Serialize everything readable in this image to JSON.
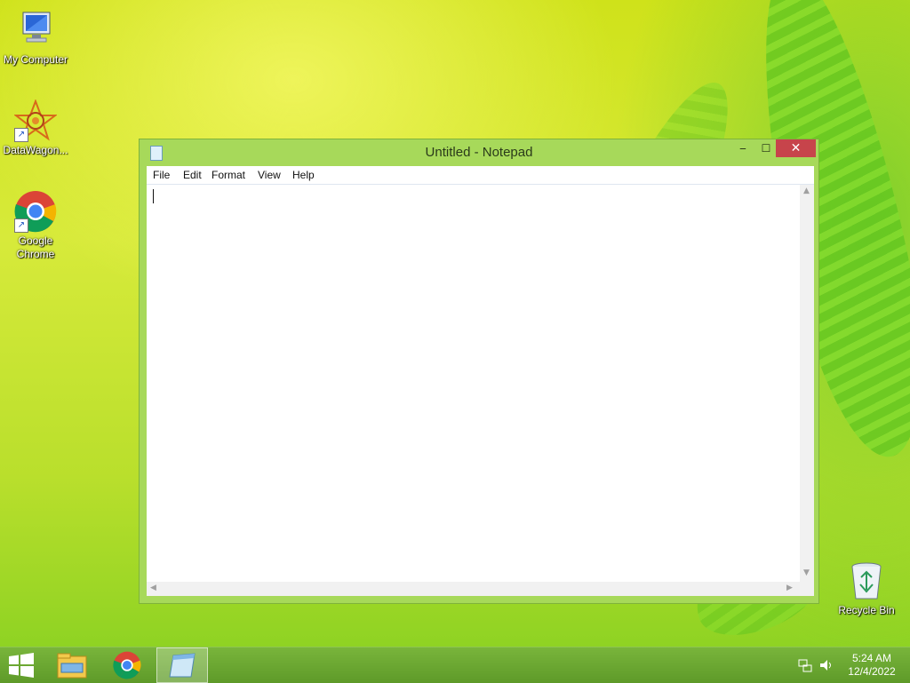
{
  "desktop": {
    "icons": [
      {
        "label": "My Computer",
        "icon": "computer-icon"
      },
      {
        "label": "DataWagon...",
        "icon": "datawagon-icon"
      },
      {
        "label": "Google Chrome",
        "icon": "chrome-icon"
      },
      {
        "label": "Recycle Bin",
        "icon": "recycle-bin-icon"
      }
    ]
  },
  "window": {
    "title": "Untitled - Notepad",
    "controls": {
      "minimize": "‒",
      "maximize": "☐",
      "close": "✕"
    },
    "menu": [
      "File",
      "Edit",
      "Format",
      "View",
      "Help"
    ],
    "content": ""
  },
  "taskbar": {
    "items": [
      "start-icon",
      "file-explorer-icon",
      "chrome-icon",
      "notepad-icon"
    ],
    "tray": {
      "time": "5:24 AM",
      "date": "12/4/2022"
    }
  },
  "colors": {
    "window_frame": "#a7d95a",
    "close_button": "#c7444b",
    "taskbar": "#6aa632"
  }
}
